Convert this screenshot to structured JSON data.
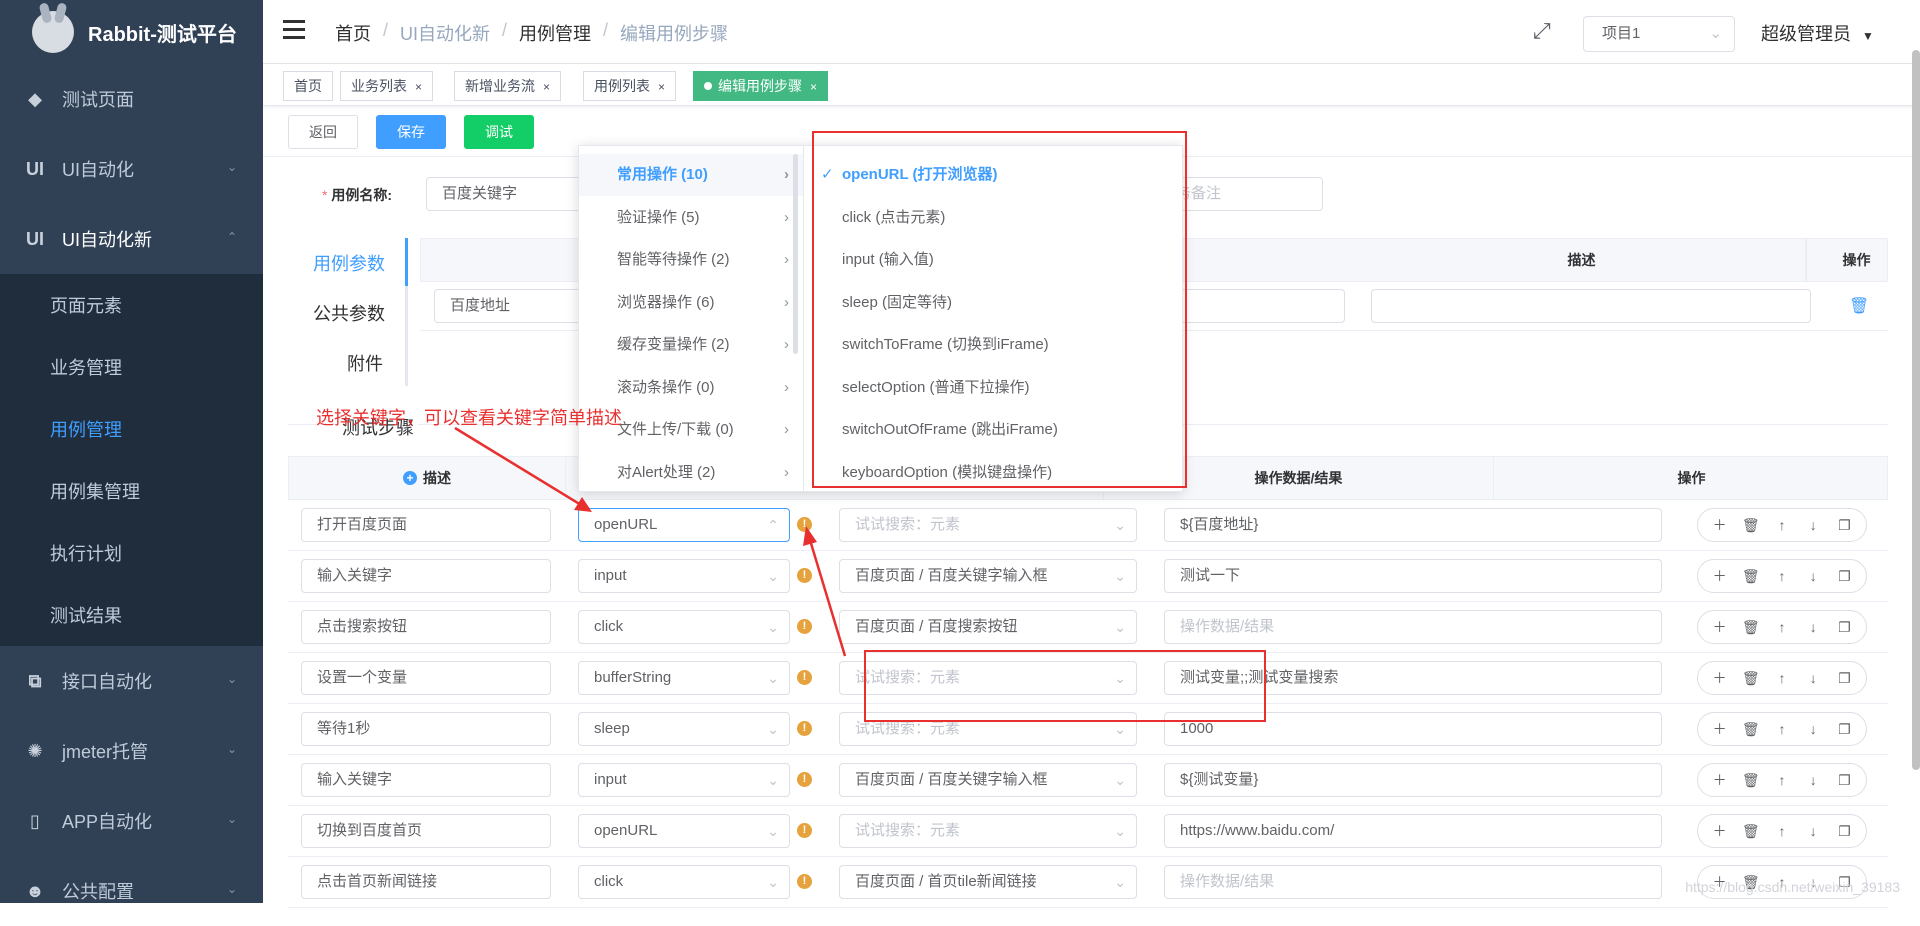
{
  "app": {
    "title": "Rabbit-测试平台"
  },
  "sidebar": {
    "items": [
      {
        "icon": "bell-icon",
        "label": "测试页面"
      },
      {
        "icon": "ui-icon",
        "label": "UI自动化"
      },
      {
        "icon": "ui-icon",
        "label": "UI自动化新"
      },
      {
        "icon": "api-icon",
        "label": "接口自动化"
      },
      {
        "icon": "jmeter-icon",
        "label": "jmeter托管"
      },
      {
        "icon": "phone-icon",
        "label": "APP自动化"
      },
      {
        "icon": "users-icon",
        "label": "公共配置"
      }
    ],
    "ui_badge": "UI",
    "sub_items": [
      "页面元素",
      "业务管理",
      "用例管理",
      "用例集管理",
      "执行计划",
      "测试结果"
    ]
  },
  "header": {
    "breadcrumb": [
      "首页",
      "UI自动化新",
      "用例管理",
      "编辑用例步骤"
    ],
    "breadcrumb_sep": "/",
    "project": "项目1",
    "user": "超级管理员"
  },
  "tags": [
    "首页",
    "业务列表",
    "新增业务流",
    "用例列表",
    "编辑用例步骤"
  ],
  "toolbar": {
    "back": "返回",
    "save": "保存",
    "debug": "调试"
  },
  "form": {
    "required_mark": "*",
    "case_name_label": "用例名称:",
    "case_name_value": "百度关键字",
    "remark_placeholder": "务备注"
  },
  "side_tabs": [
    "用例参数",
    "公共参数",
    "附件"
  ],
  "param_table": {
    "headers": [
      "描述",
      "操作"
    ],
    "row": {
      "name": "百度地址"
    }
  },
  "steps_section": {
    "title": "测试步骤"
  },
  "steps_table": {
    "headers": [
      "描述",
      "操作数据/结果",
      "操作"
    ],
    "add_icon_text": "+",
    "rows": [
      {
        "desc": "打开百度页面",
        "keyword": "openURL",
        "element": "试试搜索：元素",
        "element_ph": true,
        "data": "${百度地址}",
        "data_ph": false
      },
      {
        "desc": "输入关键字",
        "keyword": "input",
        "element": "百度页面 / 百度关键字输入框",
        "element_ph": false,
        "data": "测试一下",
        "data_ph": false
      },
      {
        "desc": "点击搜索按钮",
        "keyword": "click",
        "element": "百度页面 / 百度搜索按钮",
        "element_ph": false,
        "data": "操作数据/结果",
        "data_ph": true
      },
      {
        "desc": "设置一个变量",
        "keyword": "bufferString",
        "element": "试试搜索：元素",
        "element_ph": true,
        "data": "测试变量;;测试变量搜索",
        "data_ph": false
      },
      {
        "desc": "等待1秒",
        "keyword": "sleep",
        "element": "试试搜索：元素",
        "element_ph": true,
        "data": "1000",
        "data_ph": false
      },
      {
        "desc": "输入关键字",
        "keyword": "input",
        "element": "百度页面 / 百度关键字输入框",
        "element_ph": false,
        "data": "${测试变量}",
        "data_ph": false
      },
      {
        "desc": "切换到百度首页",
        "keyword": "openURL",
        "element": "试试搜索：元素",
        "element_ph": true,
        "data": "https://www.baidu.com/",
        "data_ph": false
      },
      {
        "desc": "点击首页新闻链接",
        "keyword": "click",
        "element": "百度页面 / 首页tile新闻链接",
        "element_ph": false,
        "data": "操作数据/结果",
        "data_ph": true
      }
    ]
  },
  "cascader": {
    "categories": [
      "常用操作 (10)",
      "验证操作 (5)",
      "智能等待操作 (2)",
      "浏览器操作 (6)",
      "缓存变量操作 (2)",
      "滚动条操作 (0)",
      "文件上传/下载 (0)",
      "对Alert处理 (2)"
    ],
    "active_category": 0,
    "options": [
      "openURL (打开浏览器)",
      "click (点击元素)",
      "input (输入值)",
      "sleep (固定等待)",
      "switchToFrame (切换到iFrame)",
      "selectOption (普通下拉操作)",
      "switchOutOfFrame (跳出iFrame)",
      "keyboardOption (模拟键盘操作)"
    ],
    "selected_option": 0
  },
  "annotation": "选择关键字，可以查看关键字简单描述",
  "watermark": "https://blog.csdn.net/weixin_39183",
  "colors": {
    "primary": "#409eff",
    "success": "#13ce66",
    "tag_active": "#42b983",
    "sidebar": "#304156",
    "annotation": "#e8312f",
    "warning": "#e6a23c"
  }
}
